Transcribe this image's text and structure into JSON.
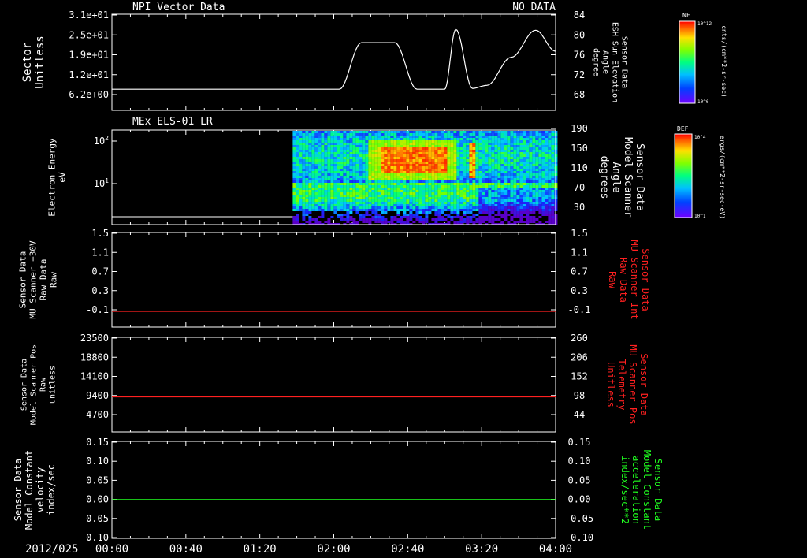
{
  "date_label": "2012/025",
  "time_axis": {
    "range": [
      "00:00",
      "04:00"
    ],
    "ticks": [
      "00:00",
      "00:40",
      "01:20",
      "02:00",
      "02:40",
      "03:20",
      "04:00"
    ]
  },
  "colors": {
    "background": "#000000",
    "axis": "#ffffff",
    "red": "#ff2020",
    "green": "#20ff20"
  },
  "panels": [
    {
      "id": "npi",
      "title_left": "NPI Vector Data",
      "title_right": "NO DATA",
      "left_label_lines": [
        "Sector",
        "Unitless"
      ],
      "left_ticks": [
        "3.1e+01",
        "2.5e+01",
        "1.9e+01",
        "1.2e+01",
        "6.2e+00"
      ],
      "right_label_lines": [
        "Sensor Data",
        "ESH Sun Elevation",
        "Angle",
        "degree"
      ],
      "right_ticks": [
        "84",
        "80",
        "76",
        "72",
        "68"
      ],
      "right_label_color": "#ffffff",
      "colorbar": {
        "tag": "NF",
        "unit": "cnts/(cm**2-sr-sec)",
        "top_label": "10^12",
        "bottom_label": "10^6"
      }
    },
    {
      "id": "els",
      "title_left": "MEx ELS-01 LR",
      "left_label_lines": [
        "Electron Energy",
        "eV"
      ],
      "left_ticks": [
        "10^2",
        "10^1"
      ],
      "right_label_lines": [
        "Sensor Data",
        "Model Scanner",
        "Angle",
        "degrees"
      ],
      "right_ticks": [
        "190",
        "150",
        "110",
        "70",
        "30"
      ],
      "right_label_color": "#ffffff",
      "colorbar": {
        "tag": "DEF",
        "unit": "ergs/(cm**2-sr-sec-eV)",
        "top_label": "10^4",
        "bottom_label": "10^1"
      }
    },
    {
      "id": "mu_raw",
      "left_label_lines": [
        "Sensor Data",
        "MU Scanner +30V",
        "Raw Data",
        "Raw"
      ],
      "left_ticks": [
        "1.5",
        "1.1",
        "0.7",
        "0.3",
        "-0.1"
      ],
      "right_label_lines": [
        "Sensor Data",
        "MU Scanner Int",
        "Raw Data",
        "Raw"
      ],
      "right_ticks": [
        "1.5",
        "1.1",
        "0.7",
        "0.3",
        "-0.1"
      ],
      "right_label_color": "#ff2020"
    },
    {
      "id": "pos",
      "left_label_lines": [
        "Sensor Data",
        "Model Scanner Pos",
        "Raw",
        "unitless"
      ],
      "left_ticks": [
        "23500",
        "18800",
        "14100",
        "9400",
        "4700"
      ],
      "right_label_lines": [
        "Sensor Data",
        "MU Scanner Pos",
        "Telemetry",
        "Unitless"
      ],
      "right_ticks": [
        "260",
        "206",
        "152",
        "98",
        "44"
      ],
      "right_label_color": "#ff2020"
    },
    {
      "id": "vel",
      "left_label_lines": [
        "Sensor Data",
        "Model Constant",
        "velocity",
        "index/sec"
      ],
      "left_ticks": [
        "0.15",
        "0.10",
        "0.05",
        "0.00",
        "-0.05",
        "-0.10"
      ],
      "right_label_lines": [
        "Sensor Data",
        "Model Constant",
        "acceleration",
        "index/sec**2"
      ],
      "right_ticks": [
        "0.15",
        "0.10",
        "0.05",
        "0.00",
        "-0.05",
        "-0.10"
      ],
      "right_label_color": "#20ff20"
    }
  ],
  "chart_data": [
    {
      "type": "line",
      "panel": "npi",
      "series_axis": "right",
      "x_hours": [
        0,
        2.05,
        2.25,
        2.55,
        2.75,
        3.0,
        3.1,
        3.25,
        3.38,
        3.6,
        3.82,
        4.0
      ],
      "y": [
        66.6,
        66.6,
        77.4,
        77.4,
        66.6,
        66.6,
        80.5,
        66.8,
        67.5,
        74.0,
        80.3,
        75.4
      ],
      "ylim": [
        65,
        84
      ],
      "color": "#ffffff"
    },
    {
      "type": "heatmap",
      "panel": "els",
      "y_scale": "log",
      "ylim_eV": [
        1.5,
        180
      ],
      "data_start_hour": 1.63,
      "hot_band_hours": [
        2.4,
        3.0
      ],
      "hot_band_eV": [
        22,
        50
      ],
      "spike_hours": [
        3.22,
        3.27
      ]
    },
    {
      "type": "line",
      "panel": "mu_raw",
      "y": [
        0.0,
        0.0
      ],
      "ylim": [
        -0.3,
        1.5
      ],
      "color": "#ff2020"
    },
    {
      "type": "line",
      "panel": "pos",
      "y": [
        8700,
        8700
      ],
      "ylim": [
        0,
        23500
      ],
      "color": "#ff2020"
    },
    {
      "type": "line",
      "panel": "vel",
      "y": [
        0.0,
        0.0
      ],
      "ylim": [
        -0.1,
        0.15
      ],
      "color": "#20ff20"
    }
  ]
}
